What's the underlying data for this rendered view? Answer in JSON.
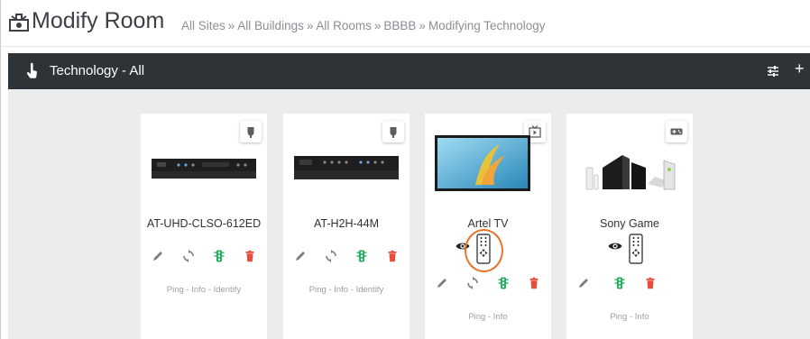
{
  "header": {
    "title": "Modify Room",
    "breadcrumb": [
      "All Sites",
      "All Buildings",
      "All Rooms",
      "BBBB",
      "Modifying Technology"
    ],
    "separator": "»"
  },
  "tech_bar": {
    "title": "Technology - All",
    "filter_icon": "sliders-icon",
    "add_label": "+"
  },
  "colors": {
    "dark_bar": "#2d3337",
    "edit": "#7a7f84",
    "sync": "#7a7f84",
    "traffic": "#27ae60",
    "delete": "#e74c3c",
    "highlight": "#e8742a"
  },
  "cards": [
    {
      "name": "AT-UHD-CLSO-612ED",
      "badge_icon": "plug-icon",
      "image": "av-switcher",
      "links": [
        "Ping",
        "Info",
        "Identify"
      ]
    },
    {
      "name": "AT-H2H-44M",
      "badge_icon": "plug-icon",
      "image": "av-matrix",
      "links": [
        "Ping",
        "Info",
        "Identify"
      ]
    },
    {
      "name": "Artel TV",
      "badge_icon": "tv-play-icon",
      "image": "tv",
      "links": [
        "Ping",
        "Info"
      ]
    },
    {
      "name": "Sony Game",
      "badge_icon": "gamepad-icon",
      "image": "game-consoles",
      "links": [
        "Ping",
        "Info"
      ]
    }
  ]
}
